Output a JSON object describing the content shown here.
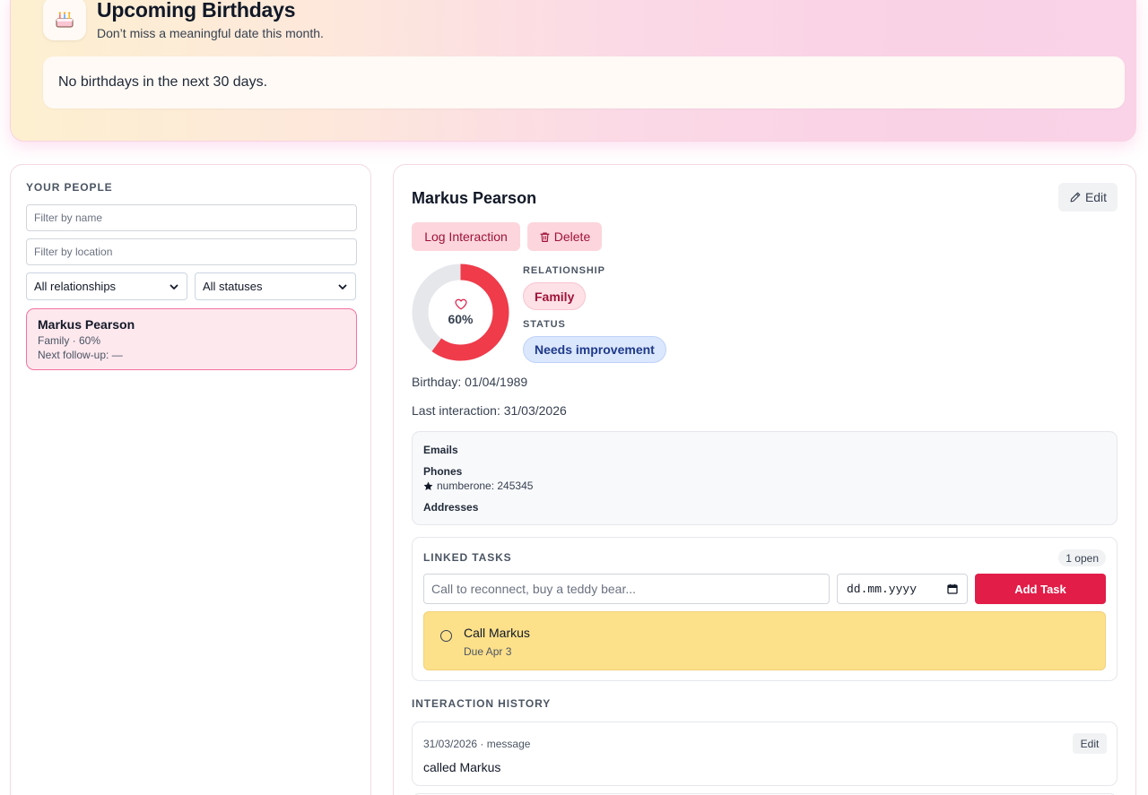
{
  "birthdays": {
    "icon": "cake-icon",
    "title": "Upcoming Birthdays",
    "subtitle": "Don’t miss a meaningful date this month.",
    "empty_message": "No birthdays in the next 30 days."
  },
  "sidebar": {
    "label": "YOUR PEOPLE",
    "filter_name_placeholder": "Filter by name",
    "filter_location_placeholder": "Filter by location",
    "relationship_select": "All relationships",
    "status_select": "All statuses",
    "people": [
      {
        "name": "Markus Pearson",
        "meta": "Family · 60%",
        "followup": "Next follow-up: —"
      }
    ]
  },
  "detail": {
    "name": "Markus Pearson",
    "edit_label": "Edit",
    "log_label": "Log Interaction",
    "delete_label": "Delete",
    "score_percent": 60,
    "score_text": "60%",
    "relationship_label": "RELATIONSHIP",
    "relationship_value": "Family",
    "status_label": "STATUS",
    "status_value": "Needs improvement",
    "birthday": "Birthday: 01/04/1989",
    "last_interaction": "Last interaction: 31/03/2026",
    "contacts": {
      "emails_label": "Emails",
      "phones_label": "Phones",
      "phone_value": "numberone: 245345",
      "addresses_label": "Addresses"
    },
    "tasks": {
      "label": "LINKED TASKS",
      "open_count": "1 open",
      "input_placeholder": "Call to reconnect, buy a teddy bear...",
      "date_placeholder": "dd.mm.yyyy",
      "add_label": "Add Task",
      "items": [
        {
          "title": "Call Markus",
          "due": "Due Apr 3"
        }
      ]
    },
    "history": {
      "label": "INTERACTION HISTORY",
      "items": [
        {
          "meta": "31/03/2026 · message",
          "text": "called Markus",
          "edit_label": "Edit"
        }
      ]
    }
  },
  "colors": {
    "accent": "#e11d48",
    "donut_fill": "#ef3b4a",
    "donut_track": "#e5e7eb",
    "task_highlight": "#fde08a"
  }
}
